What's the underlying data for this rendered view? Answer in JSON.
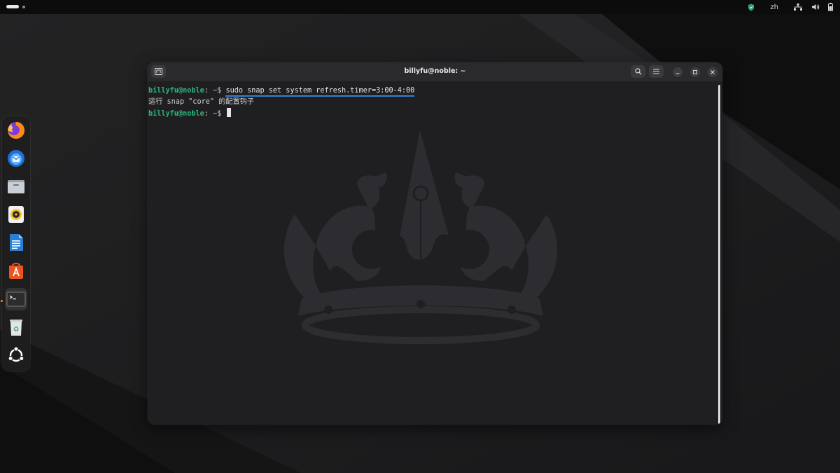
{
  "topbar": {
    "language": "zh",
    "icons": [
      "shield-icon",
      "network-icon",
      "volume-icon",
      "battery-icon"
    ]
  },
  "dock": {
    "items": [
      {
        "name": "firefox",
        "icon": "firefox-icon"
      },
      {
        "name": "thunderbird",
        "icon": "thunderbird-icon"
      },
      {
        "name": "files",
        "icon": "folder-icon"
      },
      {
        "name": "rhythmbox",
        "icon": "speaker-icon"
      },
      {
        "name": "libreoffice-writer",
        "icon": "document-icon"
      },
      {
        "name": "app-center",
        "icon": "app-store-icon"
      },
      {
        "name": "terminal",
        "icon": "terminal-icon",
        "active": true
      },
      {
        "name": "trash",
        "icon": "trash-icon"
      },
      {
        "name": "show-apps",
        "icon": "ubuntu-logo-icon"
      }
    ]
  },
  "terminal": {
    "title": "billyfu@noble: ~",
    "lines": [
      {
        "user": "billyfu@noble",
        "sep": ":",
        "path": " ~",
        "symbol": "$",
        "command": "sudo snap set system refresh.timer=3:00-4:00"
      },
      {
        "output": "运行 snap \"core\" 的配置钩子"
      },
      {
        "user": "billyfu@noble",
        "sep": ":",
        "path": " ~",
        "symbol": "$",
        "command": ""
      }
    ]
  },
  "colors": {
    "prompt_user": "#27b77a",
    "command_underline": "#2f80d5",
    "titlebar": "#2a2a2c",
    "terminal_bg": "#1f1f22"
  }
}
